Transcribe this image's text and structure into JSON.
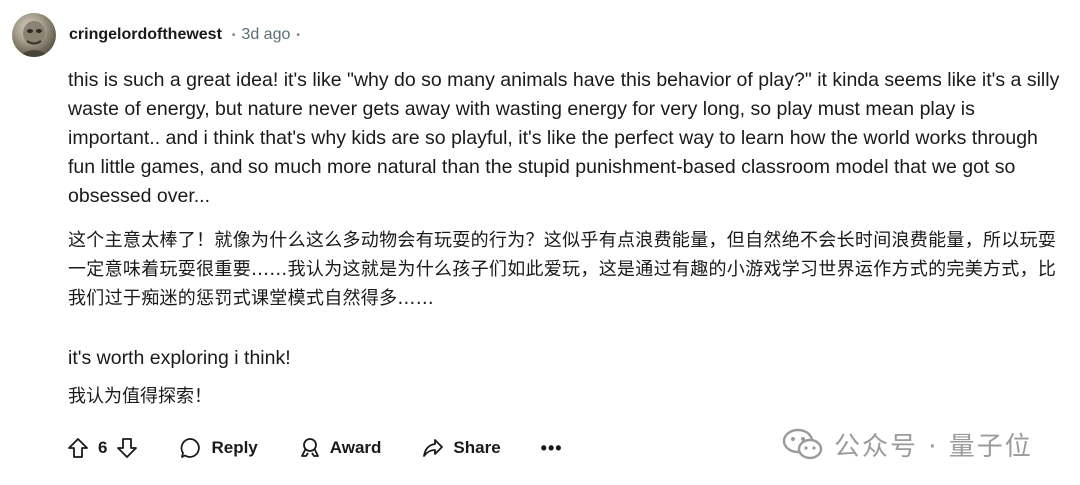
{
  "comment": {
    "username": "cringelordofthewest",
    "separator": "•",
    "time": "3d ago",
    "time_separator": "•",
    "paragraphs": {
      "en1": "this is such a great idea! it's like \"why do so many animals have this behavior of play?\" it kinda seems like it's a silly waste of energy, but nature never gets away with wasting energy for very long, so play must mean play is important.. and i think that's why kids are so playful, it's like the perfect way to learn how the world works through fun little games, and so much more natural than the stupid punishment-based classroom model that we got so obsessed over...",
      "zh1": "这个主意太棒了！就像为什么这么多动物会有玩耍的行为？这似乎有点浪费能量，但自然绝不会长时间浪费能量，所以玩耍一定意味着玩耍很重要……我认为这就是为什么孩子们如此爱玩，这是通过有趣的小游戏学习世界运作方式的完美方式，比我们过于痴迷的惩罚式课堂模式自然得多……",
      "en2": "it's worth exploring i think!",
      "zh2": "我认为值得探索！"
    }
  },
  "actions": {
    "vote_count": "6",
    "reply_label": "Reply",
    "award_label": "Award",
    "share_label": "Share",
    "more_label": "•••"
  },
  "watermark": {
    "text": "公众号 · 量子位",
    "color": "#9b9b9b"
  },
  "icons": {
    "upvote": "arrow-up-icon",
    "downvote": "arrow-down-icon",
    "reply": "speech-bubble-icon",
    "award": "award-icon",
    "share": "share-arrow-icon",
    "watermark": "wechat-icon"
  }
}
